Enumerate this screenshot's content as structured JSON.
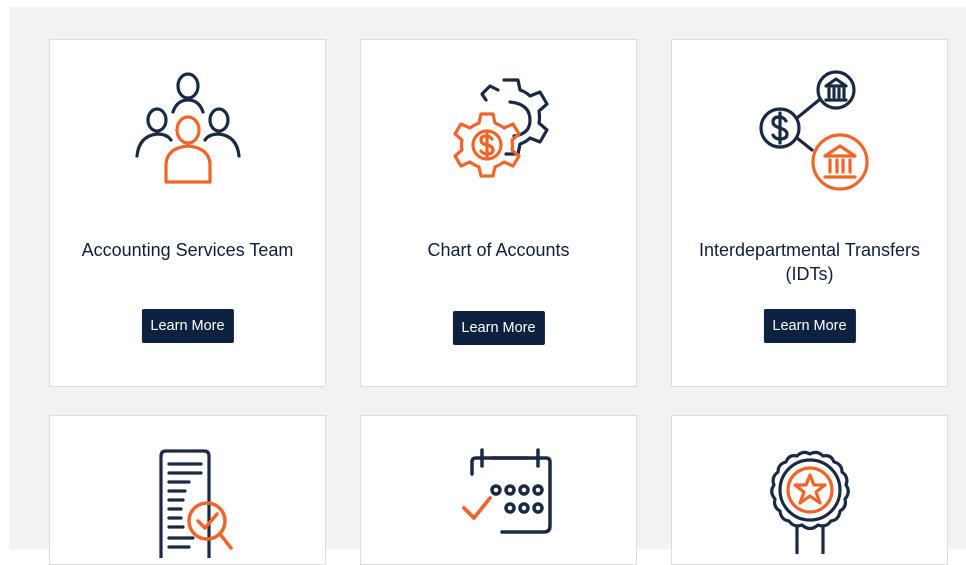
{
  "colors": {
    "navy": "#1b2a44",
    "orange": "#f0652b",
    "button_bg": "#0d2140",
    "page_bg": "#f2f2f2"
  },
  "cards": [
    {
      "title": "Accounting Services Team",
      "button_label": "Learn More",
      "icon": "team-people-icon"
    },
    {
      "title": "Chart of Accounts",
      "button_label": "Learn More",
      "icon": "gears-dollar-icon"
    },
    {
      "title": "Interdepartmental Transfers (IDTs)",
      "button_label": "Learn More",
      "icon": "bank-transfer-icon"
    },
    {
      "title": "",
      "button_label": "",
      "icon": "document-magnifier-check-icon"
    },
    {
      "title": "",
      "button_label": "",
      "icon": "calendar-check-icon"
    },
    {
      "title": "",
      "button_label": "",
      "icon": "award-badge-star-icon"
    }
  ]
}
